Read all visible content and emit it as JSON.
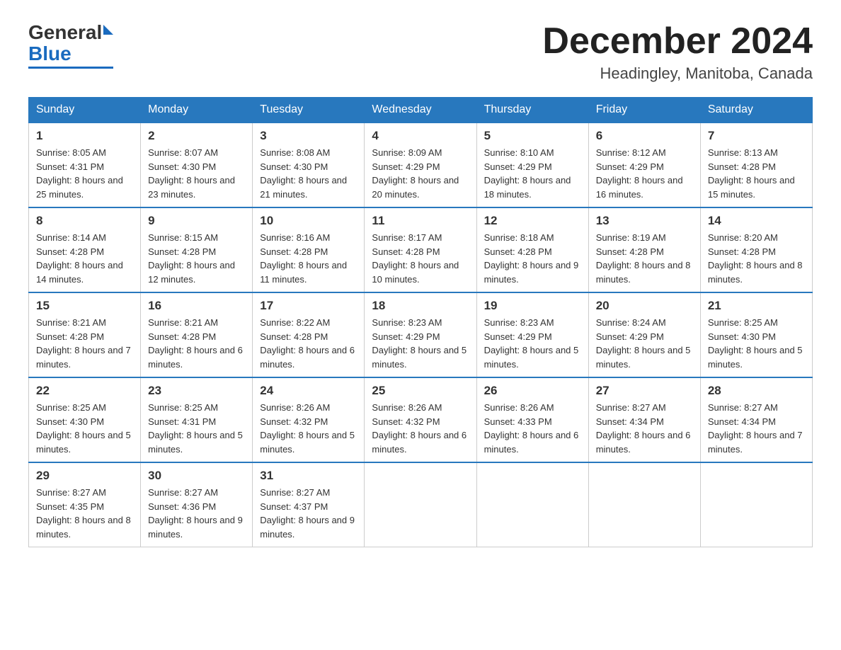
{
  "header": {
    "logo": {
      "general": "General",
      "blue": "Blue"
    },
    "title": "December 2024",
    "subtitle": "Headingley, Manitoba, Canada"
  },
  "days_of_week": [
    "Sunday",
    "Monday",
    "Tuesday",
    "Wednesday",
    "Thursday",
    "Friday",
    "Saturday"
  ],
  "weeks": [
    [
      {
        "day": "1",
        "sunrise": "8:05 AM",
        "sunset": "4:31 PM",
        "daylight": "8 hours and 25 minutes."
      },
      {
        "day": "2",
        "sunrise": "8:07 AM",
        "sunset": "4:30 PM",
        "daylight": "8 hours and 23 minutes."
      },
      {
        "day": "3",
        "sunrise": "8:08 AM",
        "sunset": "4:30 PM",
        "daylight": "8 hours and 21 minutes."
      },
      {
        "day": "4",
        "sunrise": "8:09 AM",
        "sunset": "4:29 PM",
        "daylight": "8 hours and 20 minutes."
      },
      {
        "day": "5",
        "sunrise": "8:10 AM",
        "sunset": "4:29 PM",
        "daylight": "8 hours and 18 minutes."
      },
      {
        "day": "6",
        "sunrise": "8:12 AM",
        "sunset": "4:29 PM",
        "daylight": "8 hours and 16 minutes."
      },
      {
        "day": "7",
        "sunrise": "8:13 AM",
        "sunset": "4:28 PM",
        "daylight": "8 hours and 15 minutes."
      }
    ],
    [
      {
        "day": "8",
        "sunrise": "8:14 AM",
        "sunset": "4:28 PM",
        "daylight": "8 hours and 14 minutes."
      },
      {
        "day": "9",
        "sunrise": "8:15 AM",
        "sunset": "4:28 PM",
        "daylight": "8 hours and 12 minutes."
      },
      {
        "day": "10",
        "sunrise": "8:16 AM",
        "sunset": "4:28 PM",
        "daylight": "8 hours and 11 minutes."
      },
      {
        "day": "11",
        "sunrise": "8:17 AM",
        "sunset": "4:28 PM",
        "daylight": "8 hours and 10 minutes."
      },
      {
        "day": "12",
        "sunrise": "8:18 AM",
        "sunset": "4:28 PM",
        "daylight": "8 hours and 9 minutes."
      },
      {
        "day": "13",
        "sunrise": "8:19 AM",
        "sunset": "4:28 PM",
        "daylight": "8 hours and 8 minutes."
      },
      {
        "day": "14",
        "sunrise": "8:20 AM",
        "sunset": "4:28 PM",
        "daylight": "8 hours and 8 minutes."
      }
    ],
    [
      {
        "day": "15",
        "sunrise": "8:21 AM",
        "sunset": "4:28 PM",
        "daylight": "8 hours and 7 minutes."
      },
      {
        "day": "16",
        "sunrise": "8:21 AM",
        "sunset": "4:28 PM",
        "daylight": "8 hours and 6 minutes."
      },
      {
        "day": "17",
        "sunrise": "8:22 AM",
        "sunset": "4:28 PM",
        "daylight": "8 hours and 6 minutes."
      },
      {
        "day": "18",
        "sunrise": "8:23 AM",
        "sunset": "4:29 PM",
        "daylight": "8 hours and 5 minutes."
      },
      {
        "day": "19",
        "sunrise": "8:23 AM",
        "sunset": "4:29 PM",
        "daylight": "8 hours and 5 minutes."
      },
      {
        "day": "20",
        "sunrise": "8:24 AM",
        "sunset": "4:29 PM",
        "daylight": "8 hours and 5 minutes."
      },
      {
        "day": "21",
        "sunrise": "8:25 AM",
        "sunset": "4:30 PM",
        "daylight": "8 hours and 5 minutes."
      }
    ],
    [
      {
        "day": "22",
        "sunrise": "8:25 AM",
        "sunset": "4:30 PM",
        "daylight": "8 hours and 5 minutes."
      },
      {
        "day": "23",
        "sunrise": "8:25 AM",
        "sunset": "4:31 PM",
        "daylight": "8 hours and 5 minutes."
      },
      {
        "day": "24",
        "sunrise": "8:26 AM",
        "sunset": "4:32 PM",
        "daylight": "8 hours and 5 minutes."
      },
      {
        "day": "25",
        "sunrise": "8:26 AM",
        "sunset": "4:32 PM",
        "daylight": "8 hours and 6 minutes."
      },
      {
        "day": "26",
        "sunrise": "8:26 AM",
        "sunset": "4:33 PM",
        "daylight": "8 hours and 6 minutes."
      },
      {
        "day": "27",
        "sunrise": "8:27 AM",
        "sunset": "4:34 PM",
        "daylight": "8 hours and 6 minutes."
      },
      {
        "day": "28",
        "sunrise": "8:27 AM",
        "sunset": "4:34 PM",
        "daylight": "8 hours and 7 minutes."
      }
    ],
    [
      {
        "day": "29",
        "sunrise": "8:27 AM",
        "sunset": "4:35 PM",
        "daylight": "8 hours and 8 minutes."
      },
      {
        "day": "30",
        "sunrise": "8:27 AM",
        "sunset": "4:36 PM",
        "daylight": "8 hours and 9 minutes."
      },
      {
        "day": "31",
        "sunrise": "8:27 AM",
        "sunset": "4:37 PM",
        "daylight": "8 hours and 9 minutes."
      },
      null,
      null,
      null,
      null
    ]
  ],
  "labels": {
    "sunrise": "Sunrise:",
    "sunset": "Sunset:",
    "daylight": "Daylight:"
  }
}
